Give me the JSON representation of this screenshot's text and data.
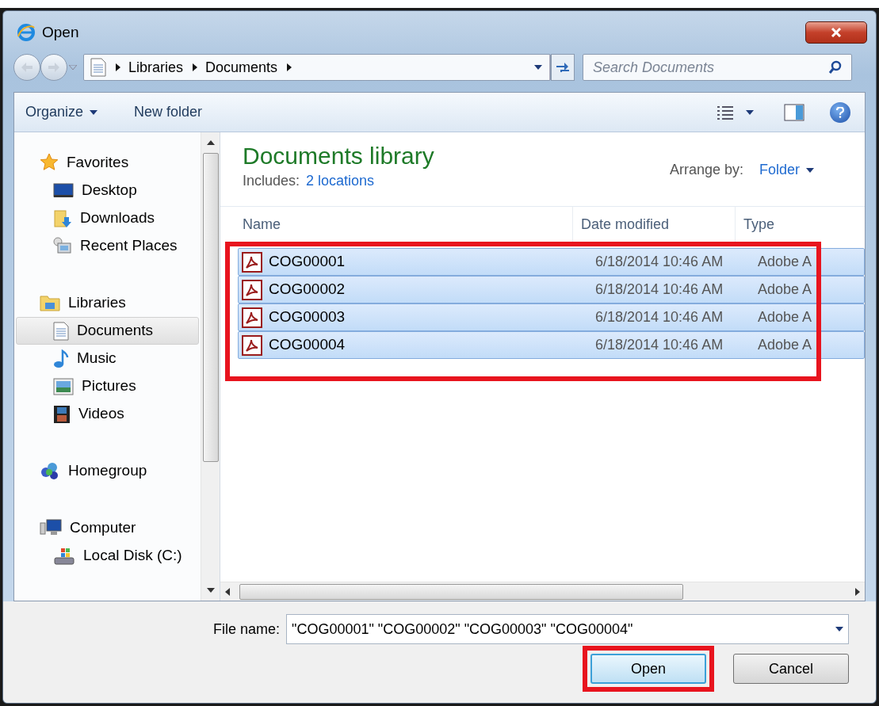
{
  "window": {
    "title": "Open"
  },
  "address": {
    "crumbs": [
      "Libraries",
      "Documents"
    ]
  },
  "search": {
    "placeholder": "Search Documents"
  },
  "toolbar": {
    "organize": "Organize",
    "new_folder": "New folder"
  },
  "sidebar": {
    "groups": [
      {
        "label": "Favorites",
        "selected": false,
        "children": [
          {
            "label": "Desktop",
            "selected": false
          },
          {
            "label": "Downloads",
            "selected": false
          },
          {
            "label": "Recent Places",
            "selected": false
          }
        ]
      },
      {
        "label": "Libraries",
        "selected": false,
        "children": [
          {
            "label": "Documents",
            "selected": true
          },
          {
            "label": "Music",
            "selected": false
          },
          {
            "label": "Pictures",
            "selected": false
          },
          {
            "label": "Videos",
            "selected": false
          }
        ]
      },
      {
        "label": "Homegroup",
        "selected": false
      },
      {
        "label": "Computer",
        "selected": false,
        "children": [
          {
            "label": "Local Disk (C:)",
            "selected": false
          }
        ]
      }
    ]
  },
  "library": {
    "title": "Documents library",
    "includes_label": "Includes:",
    "locations_link": "2 locations",
    "arrange_label": "Arrange by:",
    "arrange_value": "Folder"
  },
  "table": {
    "columns": [
      "Name",
      "Date modified",
      "Type"
    ],
    "rows": [
      {
        "name": "COG00001",
        "date": "6/18/2014 10:46 AM",
        "type": "Adobe A",
        "selected": true
      },
      {
        "name": "COG00002",
        "date": "6/18/2014 10:46 AM",
        "type": "Adobe A",
        "selected": true
      },
      {
        "name": "COG00003",
        "date": "6/18/2014 10:46 AM",
        "type": "Adobe A",
        "selected": true
      },
      {
        "name": "COG00004",
        "date": "6/18/2014 10:46 AM",
        "type": "Adobe A",
        "selected": true
      }
    ]
  },
  "file_name": {
    "label": "File name:",
    "value": "\"COG00001\" \"COG00002\" \"COG00003\" \"COG00004\""
  },
  "buttons": [
    {
      "label": "Open",
      "kind": "default"
    },
    {
      "label": "Cancel",
      "kind": "normal"
    }
  ]
}
